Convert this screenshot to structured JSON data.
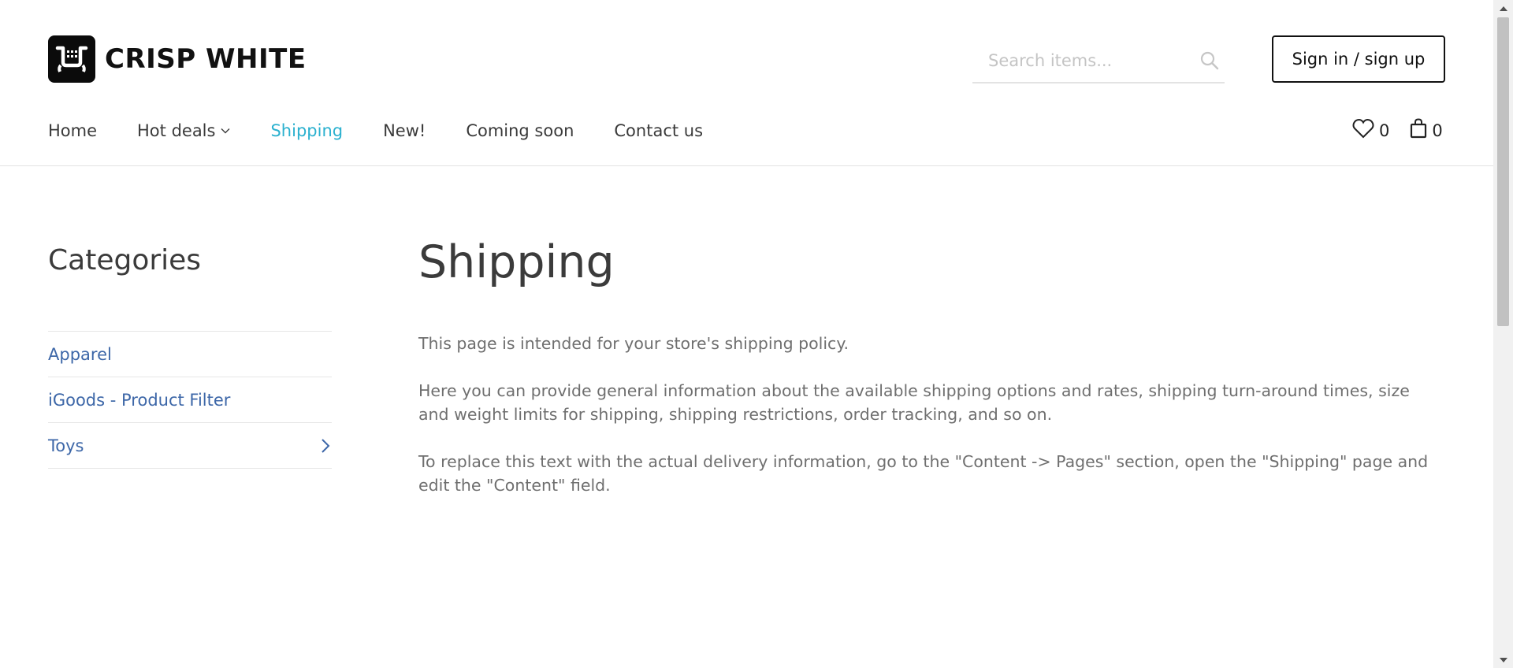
{
  "brand": {
    "name": "CRISP WHITE",
    "icon": "shopping-cart-logo-icon"
  },
  "search": {
    "placeholder": "Search items...",
    "value": "",
    "icon": "search-icon"
  },
  "auth": {
    "signin_label": "Sign in / sign up"
  },
  "nav": {
    "items": [
      {
        "label": "Home"
      },
      {
        "label": "Hot deals",
        "has_dropdown": true
      },
      {
        "label": "Shipping",
        "active": true
      },
      {
        "label": "New!"
      },
      {
        "label": "Coming soon"
      },
      {
        "label": "Contact us"
      }
    ]
  },
  "counters": {
    "wishlist": {
      "icon": "heart-icon",
      "count": "0"
    },
    "cart": {
      "icon": "shopping-bag-icon",
      "count": "0"
    }
  },
  "sidebar": {
    "title": "Categories",
    "items": [
      {
        "label": "Apparel"
      },
      {
        "label": "iGoods - Product Filter"
      },
      {
        "label": "Toys",
        "expandable": true
      }
    ]
  },
  "content": {
    "title": "Shipping",
    "paragraphs": [
      "This page is intended for your store's shipping policy.",
      "Here you can provide general information about the available shipping options and rates, shipping turn-around times, size and weight limits for shipping, shipping restrictions, order tracking, and so on.",
      "To replace this text with the actual delivery information, go to the \"Content -> Pages\" section, open the \"Shipping\" page and edit the \"Content\" field."
    ]
  },
  "colors": {
    "accent_active_nav": "#2bb1cf",
    "category_link": "#3d67a8",
    "body_text": "#6f6f6f",
    "heading": "#3b3b3b"
  }
}
